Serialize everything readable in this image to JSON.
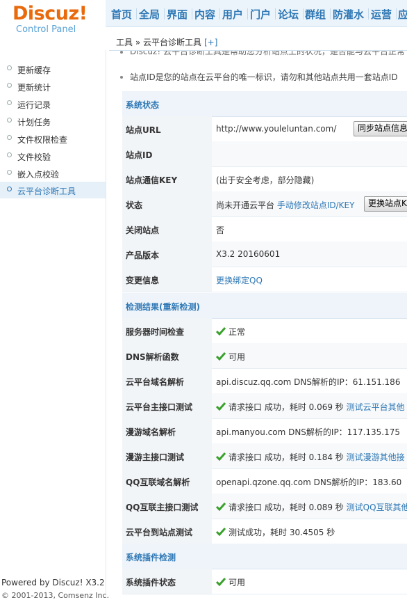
{
  "logo": {
    "main": "Discuz!",
    "sub": "Control Panel"
  },
  "topnav": [
    "首页",
    "全局",
    "界面",
    "内容",
    "用户",
    "门户",
    "论坛",
    "群组",
    "防灌水",
    "运营",
    "应"
  ],
  "breadcrumb": {
    "path": "工具 » 云平台诊断工具",
    "add": "[+]"
  },
  "sidebar": {
    "items": [
      "更新缓存",
      "更新统计",
      "运行记录",
      "计划任务",
      "文件权限检查",
      "文件校验",
      "嵌入点校验",
      "云平台诊断工具"
    ],
    "active_index": 7
  },
  "footer": {
    "powered": "Powered by Discuz! X3.2",
    "copyright": "© 2001-2013, Comsenz Inc."
  },
  "tips": [
    "Discuz! 云平台诊断工具是帮助您分析站点上的状况，是否能与云平台正常",
    "站点ID是您的站点在云平台的唯一标识，请勿和其他站点共用一套站点ID"
  ],
  "system_status": {
    "title": "系统状态",
    "rows": {
      "site_url": {
        "label": "站点URL",
        "value": "http://www.youleluntan.com/",
        "button": "同步站点信息"
      },
      "site_id": {
        "label": "站点ID",
        "value": ""
      },
      "site_key": {
        "label": "站点通信KEY",
        "value": "(出于安全考虑，部分隐藏)"
      },
      "status": {
        "label": "状态",
        "value": "尚未开通云平台",
        "link": "手动修改站点ID/KEY",
        "button": "更换站点K"
      },
      "closed": {
        "label": "关闭站点",
        "value": "否"
      },
      "version": {
        "label": "产品版本",
        "value": "X3.2 20160601"
      },
      "change": {
        "label": "变更信息",
        "link": "更换绑定QQ"
      }
    }
  },
  "check_results": {
    "title": "检测结果(重新检测)",
    "rows": {
      "time": {
        "label": "服务器时间检查",
        "value": "正常"
      },
      "dns": {
        "label": "DNS解析函数",
        "value": "可用"
      },
      "cloud_domain": {
        "label": "云平台域名解析",
        "value": "api.discuz.qq.com DNS解析的IP：61.151.186"
      },
      "cloud_api": {
        "label": "云平台主接口测试",
        "value": "请求接口 成功，耗时 0.069 秒",
        "link": "测试云平台其他"
      },
      "manyou_domain": {
        "label": "漫游域名解析",
        "value": "api.manyou.com DNS解析的IP：117.135.175"
      },
      "manyou_api": {
        "label": "漫游主接口测试",
        "value": "请求接口 成功，耗时 0.184 秒",
        "link": "测试漫游其他接"
      },
      "qq_domain": {
        "label": "QQ互联域名解析",
        "value": "openapi.qzone.qq.com DNS解析的IP：183.60"
      },
      "qq_api": {
        "label": "QQ互联主接口测试",
        "value": "请求接口 成功，耗时 0.089 秒",
        "link": "测试QQ互联其他"
      },
      "site_test": {
        "label": "云平台到站点测试",
        "value": "测试成功，耗时 30.4505 秒"
      }
    }
  },
  "plugin_check": {
    "title": "系统插件检测",
    "rows": {
      "plugin_status": {
        "label": "系统插件状态",
        "value": "可用"
      }
    }
  },
  "colors": {
    "accent": "#2f78b5",
    "logo": "#e86a0c",
    "check": "#3aa02c"
  }
}
